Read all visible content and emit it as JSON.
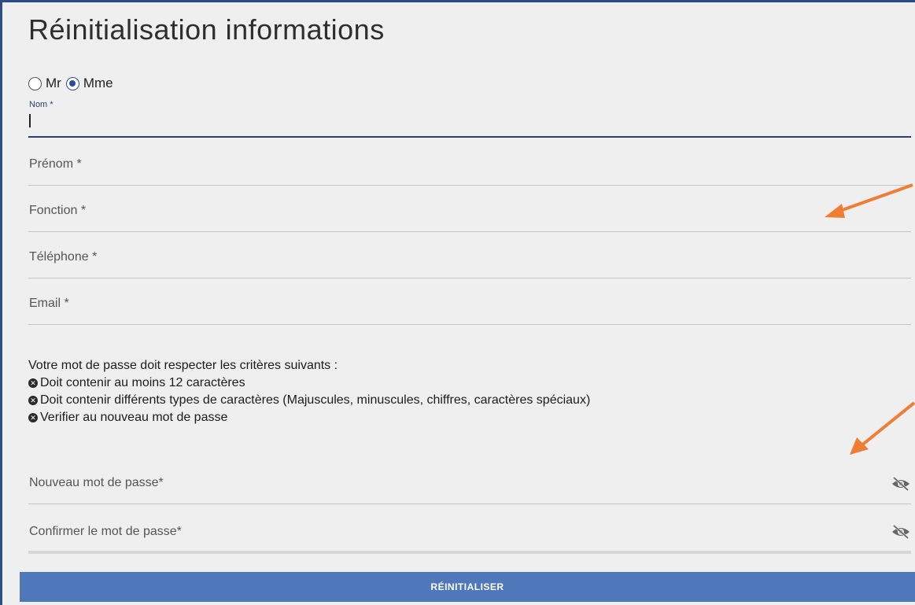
{
  "page": {
    "title": "Réinitialisation informations"
  },
  "civility": {
    "options": [
      {
        "label": "Mr",
        "checked": false
      },
      {
        "label": "Mme",
        "checked": true
      }
    ]
  },
  "fields": {
    "nom": {
      "label": "Nom *",
      "value": ""
    },
    "prenom": {
      "placeholder": "Prénom *"
    },
    "fonction": {
      "placeholder": "Fonction *"
    },
    "telephone": {
      "placeholder": "Téléphone *"
    },
    "email": {
      "placeholder": "Email *"
    }
  },
  "password_rules": {
    "heading": "Votre mot de passe doit respecter les critères suivants :",
    "items": [
      "Doit contenir au moins 12 caractères",
      "Doit contenir différents types de caractères (Majuscules, minuscules, chiffres, caractères spéciaux)",
      "Verifier au nouveau mot de passe"
    ],
    "item_icon": "error-circle-icon"
  },
  "password_fields": {
    "new": {
      "placeholder": "Nouveau mot de passe*",
      "toggle_icon": "eye-off-icon"
    },
    "confirm": {
      "placeholder": "Confirmer le mot de passe*",
      "toggle_icon": "eye-off-icon"
    }
  },
  "actions": {
    "submit_label": "RÉINITIALISER"
  },
  "colors": {
    "accent": "#2e3d78",
    "button": "#4f78ba",
    "annotation_arrow": "#ef7d33",
    "frame_border": "#2b4c86"
  }
}
